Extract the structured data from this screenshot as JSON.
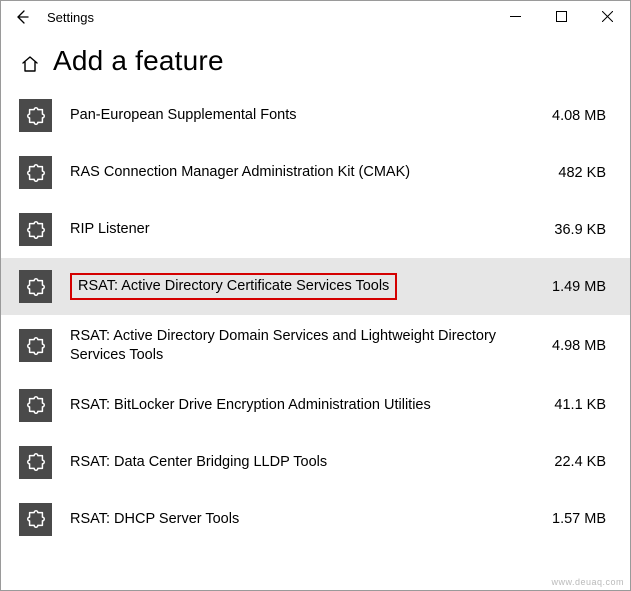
{
  "titlebar": {
    "title": "Settings"
  },
  "header": {
    "page_title": "Add a feature"
  },
  "features": [
    {
      "label": "Pan-European Supplemental Fonts",
      "size": "4.08 MB",
      "selected": false,
      "highlighted": false
    },
    {
      "label": "RAS Connection Manager Administration Kit (CMAK)",
      "size": "482 KB",
      "selected": false,
      "highlighted": false
    },
    {
      "label": "RIP Listener",
      "size": "36.9 KB",
      "selected": false,
      "highlighted": false
    },
    {
      "label": "RSAT: Active Directory Certificate Services Tools",
      "size": "1.49 MB",
      "selected": true,
      "highlighted": true
    },
    {
      "label": "RSAT: Active Directory Domain Services and Lightweight Directory Services Tools",
      "size": "4.98 MB",
      "selected": false,
      "highlighted": false
    },
    {
      "label": "RSAT: BitLocker Drive Encryption Administration Utilities",
      "size": "41.1 KB",
      "selected": false,
      "highlighted": false
    },
    {
      "label": "RSAT: Data Center Bridging LLDP Tools",
      "size": "22.4 KB",
      "selected": false,
      "highlighted": false
    },
    {
      "label": "RSAT: DHCP Server Tools",
      "size": "1.57 MB",
      "selected": false,
      "highlighted": false
    }
  ],
  "watermark": "www.deuaq.com"
}
